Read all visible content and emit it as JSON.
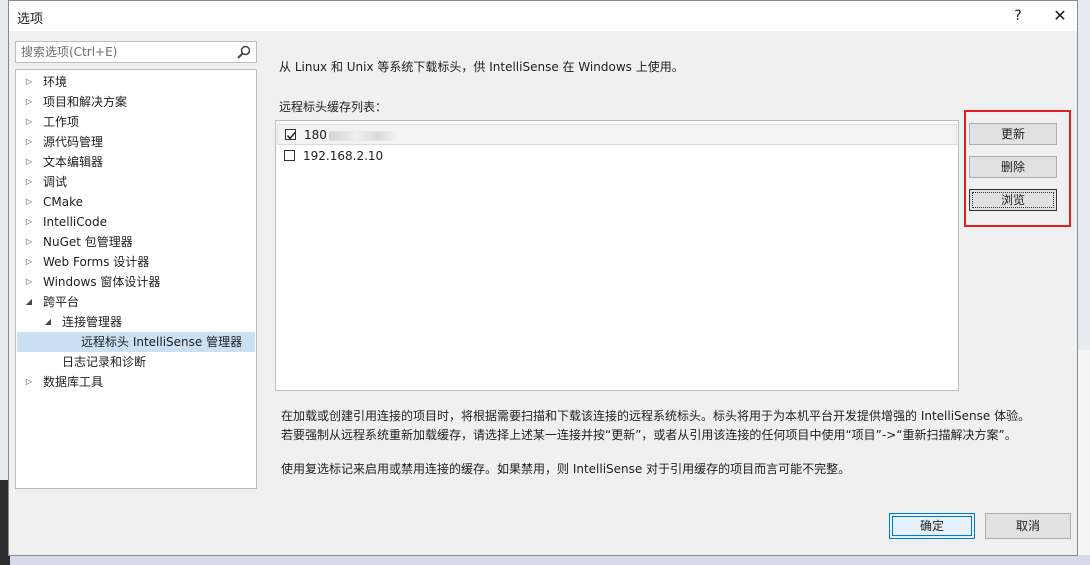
{
  "window": {
    "title": "选项",
    "help_label": "?",
    "close_label": "✕"
  },
  "search": {
    "placeholder": "搜索选项(Ctrl+E)"
  },
  "tree": {
    "items": [
      {
        "label": "环境",
        "expander": "collapsed"
      },
      {
        "label": "项目和解决方案",
        "expander": "collapsed"
      },
      {
        "label": "工作项",
        "expander": "collapsed"
      },
      {
        "label": "源代码管理",
        "expander": "collapsed"
      },
      {
        "label": "文本编辑器",
        "expander": "collapsed"
      },
      {
        "label": "调试",
        "expander": "collapsed"
      },
      {
        "label": "CMake",
        "expander": "collapsed"
      },
      {
        "label": "IntelliCode",
        "expander": "collapsed"
      },
      {
        "label": "NuGet 包管理器",
        "expander": "collapsed"
      },
      {
        "label": "Web Forms 设计器",
        "expander": "collapsed"
      },
      {
        "label": "Windows 窗体设计器",
        "expander": "collapsed"
      },
      {
        "label": "跨平台",
        "expander": "expanded"
      },
      {
        "label": "连接管理器",
        "expander": "expanded"
      },
      {
        "label": "远程标头 IntelliSense 管理器",
        "expander": "none",
        "selected": true
      },
      {
        "label": "日志记录和诊断",
        "expander": "none"
      },
      {
        "label": "数据库工具",
        "expander": "collapsed"
      }
    ]
  },
  "panel": {
    "description": "从 Linux 和 Unix 等系统下载标头，供 IntelliSense 在 Windows 上使用。",
    "list_label": "远程标头缓存列表：",
    "cache_list": [
      {
        "label": "180",
        "checked": true,
        "partially_obscured": true
      },
      {
        "label": "192.168.2.10",
        "checked": false
      }
    ],
    "buttons": {
      "update": "更新",
      "delete": "删除",
      "browse": "浏览"
    },
    "info_line1": "在加载或创建引用连接的项目时，将根据需要扫描和下载该连接的远程系统标头。标头将用于为本机平台开发提供增强的 IntelliSense 体验。",
    "info_line2": "若要强制从远程系统重新加载缓存，请选择上述某一连接并按“更新”，或者从引用该连接的任何项目中使用“项目”->“重新扫描解决方案”。",
    "info_line3": "使用复选标记来启用或禁用连接的缓存。如果禁用，则 IntelliSense 对于引用缓存的项目而言可能不完整。"
  },
  "footer": {
    "ok": "确定",
    "cancel": "取消"
  },
  "colors": {
    "highlight_frame": "#e02020",
    "selection": "#cce0f4",
    "default_button_border": "#0078d7"
  }
}
